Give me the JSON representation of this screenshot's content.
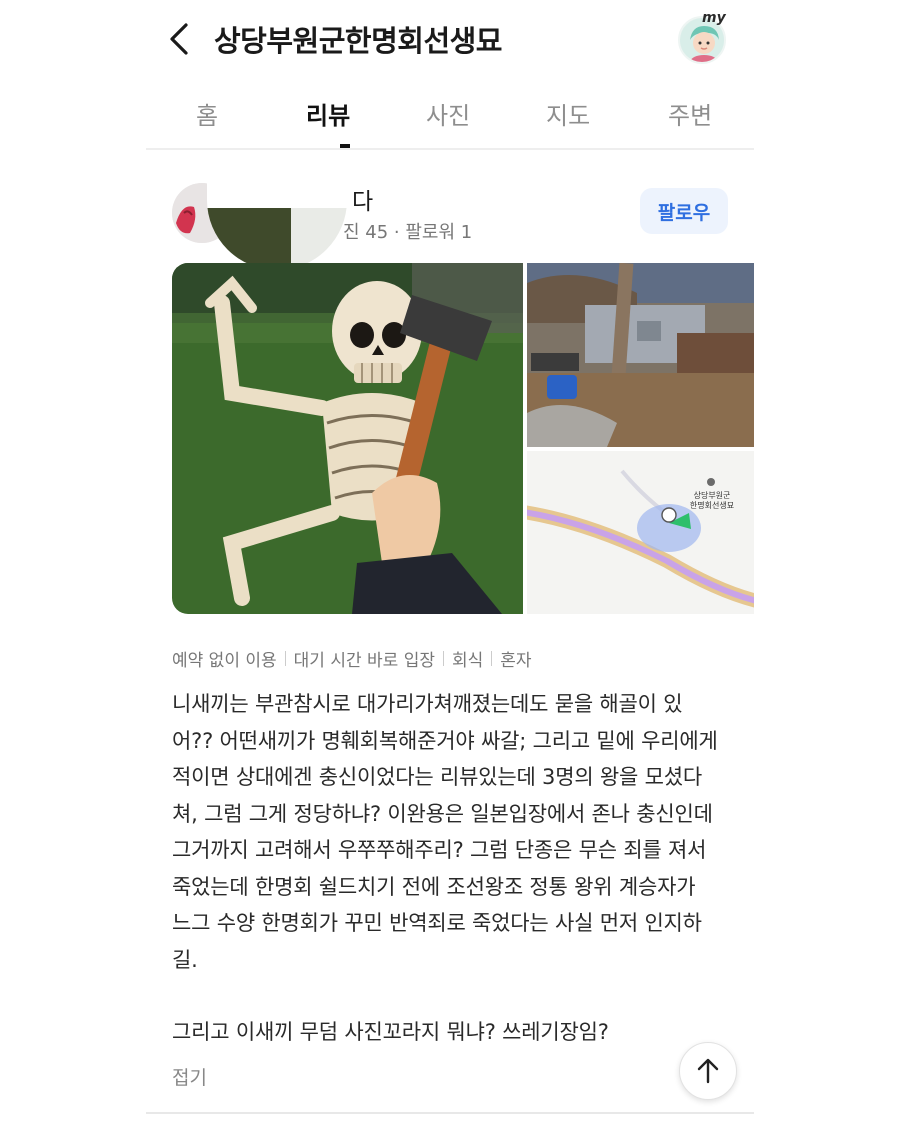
{
  "header": {
    "title": "상당부원군한명회선생묘",
    "my_label": "my"
  },
  "tabs": [
    {
      "label": "홈"
    },
    {
      "label": "리뷰"
    },
    {
      "label": "사진"
    },
    {
      "label": "지도"
    },
    {
      "label": "주변"
    }
  ],
  "active_tab": "리뷰",
  "reviewer": {
    "name": "다",
    "stats": "진 45 · 팔로워 1",
    "follow_label": "팔로우"
  },
  "map": {
    "place_line1": "상당부원군",
    "place_line2": "한명회선생묘"
  },
  "tags": [
    "예약 없이 이용",
    "대기 시간 바로 입장",
    "회식",
    "혼자"
  ],
  "review": {
    "lines": [
      "니새끼는 부관참시로 대가리가쳐깨졌는데도 묻을 해골이 있",
      "어?? 어떤새끼가 명훼회복해준거야 싸갈; 그리고 밑에 우리에게",
      "적이면 상대에겐 충신이었다는 리뷰있는데 3명의 왕을 모셨다",
      "쳐, 그럼 그게 정당하냐? 이완용은 일본입장에서 존나 충신인데",
      "그거까지 고려해서 우쭈쭈해주리? 그럼 단종은 무슨 죄를 져서",
      "죽었는데 한명회 쉴드치기 전에 조선왕조 정통 왕위 계승자가",
      "느그 수양 한명회가 꾸민 반역죄로 죽었다는 사실 먼저 인지하",
      "길."
    ],
    "last_line": "그리고 이새끼 무덤 사진꼬라지 뭐냐? 쓰레기장임?",
    "collapse_label": "접기"
  },
  "icons": {
    "back": "chevron-left-icon",
    "scroll_top": "arrow-up-icon"
  },
  "colors": {
    "accent_blue": "#2f6fe0",
    "follow_bg": "#edf3fd",
    "map_road": "#c9a3e8",
    "map_marker_green": "#2ebf6b"
  }
}
